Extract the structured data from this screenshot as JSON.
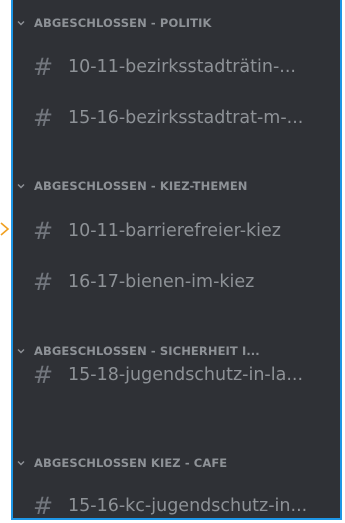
{
  "sidebar": {
    "categories": [
      {
        "label": "ABGESCHLOSSEN - POLITIK",
        "icon": "chevron-down-icon",
        "channels": [
          {
            "icon": "hash-icon",
            "name": "10-11-bezirksstadträtin-..."
          },
          {
            "icon": "hash-icon",
            "name": "15-16-bezirksstadtrat-m-..."
          }
        ]
      },
      {
        "label": "ABGESCHLOSSEN - KIEZ-THEMEN",
        "icon": "chevron-down-icon",
        "channels": [
          {
            "icon": "hash-icon",
            "name": "10-11-barrierefreier-kiez"
          },
          {
            "icon": "hash-icon",
            "name": "16-17-bienen-im-kiez"
          }
        ]
      },
      {
        "label": "ABGESCHLOSSEN - SICHERHEIT I...",
        "icon": "chevron-down-icon",
        "channels": [
          {
            "icon": "hash-icon",
            "name": "15-18-jugendschutz-in-la..."
          }
        ]
      },
      {
        "label": "ABGESCHLOSSEN KIEZ - CAFE",
        "icon": "chevron-down-icon",
        "channels": [
          {
            "icon": "hash-icon",
            "name": "15-16-kc-jugendschutz-in..."
          }
        ]
      }
    ],
    "hash_glyph": "#"
  },
  "colors": {
    "background": "#2f3136",
    "category_text": "#8e9297",
    "channel_text": "#8e9297",
    "hash_icon": "#72767d",
    "panel_border": "#1e96e6",
    "marker": "#f0a020"
  }
}
